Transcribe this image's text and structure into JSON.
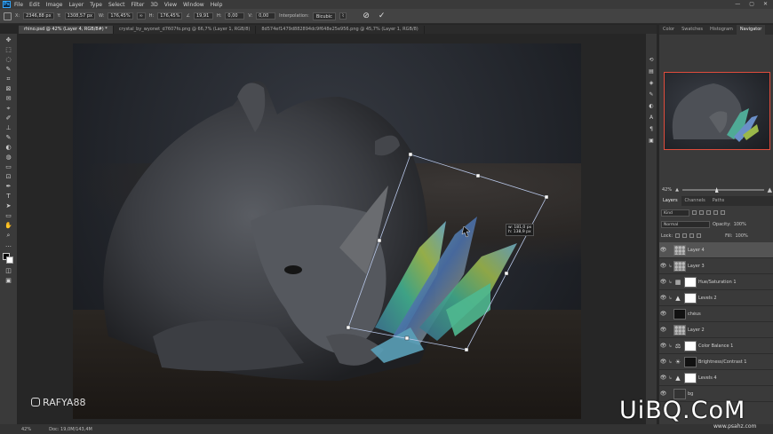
{
  "app": {
    "logo": "Ps"
  },
  "menu": [
    "File",
    "Edit",
    "Image",
    "Layer",
    "Type",
    "Select",
    "Filter",
    "3D",
    "View",
    "Window",
    "Help"
  ],
  "window_controls": [
    "—",
    "▢",
    "✕"
  ],
  "options": {
    "x_label": "X:",
    "x_value": "2346,88 px",
    "y_label": "Y:",
    "y_value": "1308,57 px",
    "w_label": "W:",
    "w_value": "176,45%",
    "link_icon": "link-icon",
    "h_label": "H:",
    "h_value": "176,45%",
    "angle_label": "∠",
    "angle_value": "19,91",
    "hskew_label": "H:",
    "hskew_value": "0,00",
    "vskew_label": "V:",
    "vskew_value": "0,00",
    "interpolation_label": "Interpolation:",
    "interpolation_value": "Bicubic",
    "cancel": "⊘",
    "commit": "✓"
  },
  "doc_tabs": [
    "rhino.psd @ 42% (Layer 4, RGB/8#) *",
    "crystal_by_wyonet_d7607fo.png @ 66,7% (Layer 1, RGB/8)",
    "8d574ef1479d882894dc9f648e25e956.png @ 45,7% (Layer 1, RGB/8)"
  ],
  "tools": [
    "✥",
    "⬚",
    "◌",
    "✎",
    "⌗",
    "⊠",
    "✉",
    "⌖",
    "✐",
    "⊥",
    "✎",
    "◐",
    "◍",
    "▭",
    "⊡",
    "✒",
    "T",
    "➤",
    "▭",
    "✋",
    "⌕",
    "…"
  ],
  "transform_tooltip": {
    "line1": "w: 181,0 px",
    "line2": "h: 138,9 px"
  },
  "watermark": "RAFYA88",
  "status": {
    "zoom": "42%",
    "doc": "Doc: 19,0M/143,4M"
  },
  "right_panel": {
    "top_tabs": [
      "Color",
      "Swatches",
      "Histogram",
      "Navigator"
    ],
    "nav_zoom": "42%",
    "layers_tabs": [
      "Layers",
      "Channels",
      "Paths"
    ],
    "kind_label": "Kind",
    "blend_mode": "Normal",
    "opacity_label": "Opacity:",
    "opacity_value": "100%",
    "lock_label": "Lock:",
    "fill_label": "Fill:",
    "fill_value": "100%",
    "layers": [
      {
        "name": "Layer 4",
        "thumb": "check",
        "selected": true,
        "clipped": false
      },
      {
        "name": "Layer 3",
        "thumb": "check",
        "selected": false,
        "clipped": true
      },
      {
        "name": "Hue/Saturation 1",
        "thumb": "white",
        "selected": false,
        "clipped": true,
        "adj": "▦"
      },
      {
        "name": "Levels 2",
        "thumb": "white",
        "selected": false,
        "clipped": true,
        "adj": "▲"
      },
      {
        "name": "chéus",
        "thumb": "black",
        "selected": false,
        "clipped": false
      },
      {
        "name": "Layer 2",
        "thumb": "check",
        "selected": false,
        "clipped": false
      },
      {
        "name": "Color Balance 1",
        "thumb": "white",
        "selected": false,
        "clipped": true,
        "adj": "⚖"
      },
      {
        "name": "Brightness/Contrast 1",
        "thumb": "black",
        "selected": false,
        "clipped": true,
        "adj": "☀"
      },
      {
        "name": "Levels 4",
        "thumb": "white",
        "selected": false,
        "clipped": true,
        "adj": "▲"
      },
      {
        "name": "bg",
        "thumb": "dark",
        "selected": false,
        "clipped": false
      }
    ]
  },
  "site_logo": "UiBQ.CoM",
  "site_logo_sub": "www.psahz.com"
}
